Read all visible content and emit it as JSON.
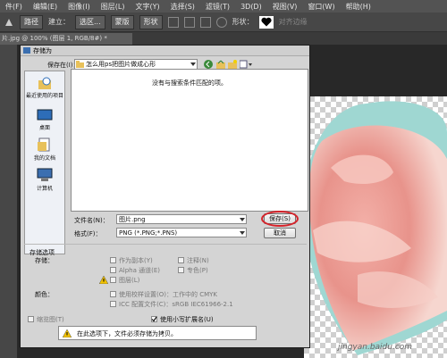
{
  "app": {
    "menu": [
      "件(F)",
      "编辑(E)",
      "图像(I)",
      "图层(L)",
      "文字(Y)",
      "选择(S)",
      "滤镜(T)",
      "3D(D)",
      "视图(V)",
      "窗口(W)",
      "帮助(H)"
    ],
    "options": {
      "tool_select": "路径",
      "build_label": "建立：",
      "selection_btn": "选区...",
      "mask_btn": "蒙版",
      "shape_btn": "形状",
      "shape_label": "形状：",
      "align_edges": "对齐边缘"
    },
    "doc_tab": "片.jpg @ 100% (图层 1, RGB/8#) *"
  },
  "dialog": {
    "title": "存储为",
    "save_in_label": "保存在(I)：",
    "save_in_value": "怎么用ps把图片做成心形",
    "empty_message": "没有与搜索条件匹配的项。",
    "places": [
      "最近使用的项目",
      "桌面",
      "我的文档",
      "计算机"
    ],
    "filename_label": "文件名(N)：",
    "filename_value": "图片.png",
    "format_label": "格式(F)：",
    "format_value": "PNG (*.PNG;*.PNS)",
    "save_button": "保存(S)",
    "cancel_button": "取消",
    "save_options_title": "存储选项",
    "storage_label": "存储：",
    "as_copy": "作为副本(Y)",
    "notes": "注释(N)",
    "alpha": "Alpha 通道(E)",
    "spot": "专色(P)",
    "layers": "图层(L)",
    "color_label": "颜色：",
    "proof": "使用校样设置(O)：工作中的 CMYK",
    "icc": "ICC 配置文件(C)：sRGB IEC61966-2.1",
    "thumbnail": "缩览图(T)",
    "lowercase_ext": "使用小写扩展名(U)",
    "warning_text": "在此选项下，文件必须存储为拷贝。"
  },
  "watermark": "jingyan.baidu.com",
  "colors": {
    "ps_bg": "#282828",
    "dialog_bg": "#d4d4d4",
    "save_ring": "#d6232a"
  }
}
